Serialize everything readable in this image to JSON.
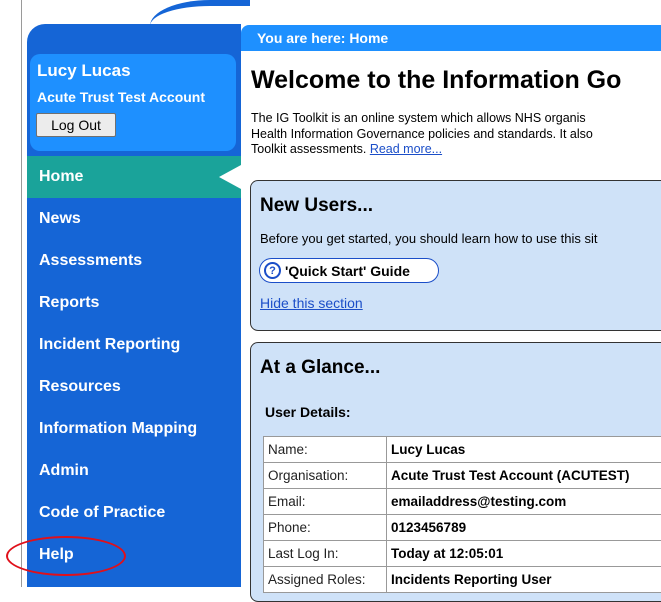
{
  "user": {
    "name": "Lucy Lucas",
    "account": "Acute Trust Test Account",
    "logout_label": "Log Out"
  },
  "nav": {
    "items": [
      {
        "label": "Home",
        "active": true
      },
      {
        "label": "News"
      },
      {
        "label": "Assessments"
      },
      {
        "label": "Reports"
      },
      {
        "label": "Incident Reporting"
      },
      {
        "label": "Resources"
      },
      {
        "label": "Information Mapping"
      },
      {
        "label": "Admin"
      },
      {
        "label": "Code of Practice"
      },
      {
        "label": "Help"
      }
    ]
  },
  "breadcrumb": "You are here: Home",
  "main": {
    "title": "Welcome to the Information Go",
    "intro": {
      "line1": "The IG Toolkit is an online system which allows NHS organis",
      "line2": "Health Information Governance policies and standards. It also",
      "line3": "Toolkit assessments.",
      "read_more": "Read more..."
    }
  },
  "new_users": {
    "heading": "New Users...",
    "text": "Before you get started, you should learn how to use this sit",
    "quick_start_icon": "question-mark-icon",
    "quick_start_label": "'Quick Start' Guide",
    "hide_label": "Hide this section"
  },
  "at_a_glance": {
    "heading": "At a Glance...",
    "user_details_label": "User Details:",
    "rows": [
      {
        "key": "Name:",
        "value": "Lucy Lucas"
      },
      {
        "key": "Organisation:",
        "value": "Acute Trust Test Account (ACUTEST)"
      },
      {
        "key": "Email:",
        "value": "emailaddress@testing.com"
      },
      {
        "key": "Phone:",
        "value": "0123456789"
      },
      {
        "key": "Last Log In:",
        "value": "Today at 12:05:01"
      },
      {
        "key": "Assigned Roles:",
        "value": "Incidents Reporting User"
      }
    ]
  },
  "colors": {
    "sidebar": "#1565d6",
    "active_nav": "#1aa39a",
    "panel": "#cfe2f8",
    "link": "#1b4ec8",
    "highlight_circle": "#e0101a"
  }
}
